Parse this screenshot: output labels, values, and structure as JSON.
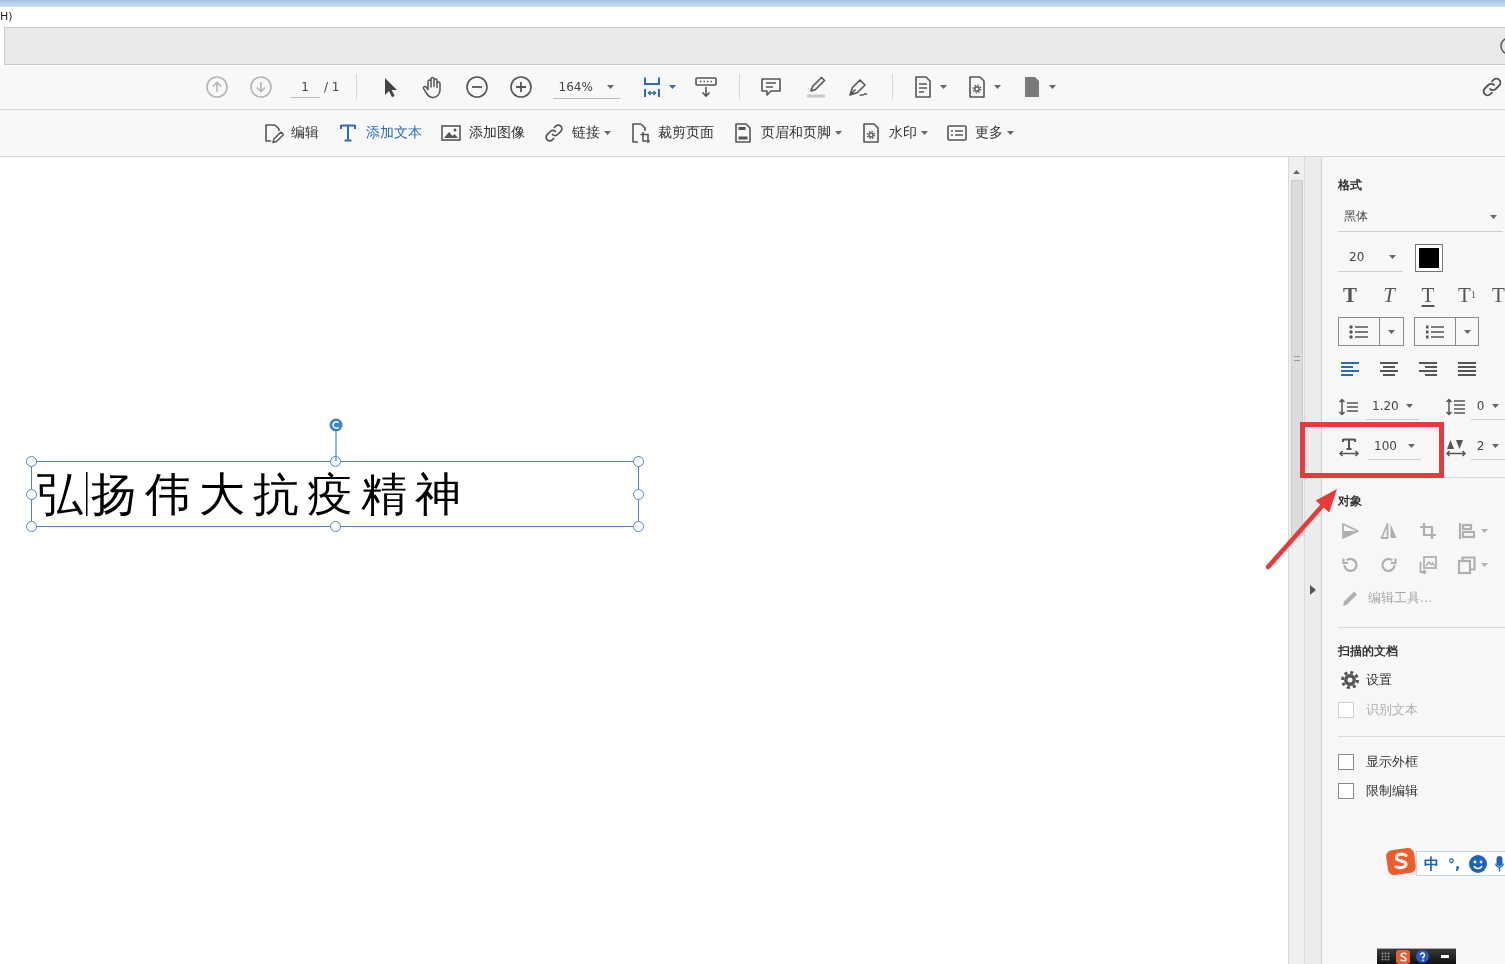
{
  "menu_bar": {
    "text": "H)"
  },
  "toolbar": {
    "nav": [
      {
        "disabled": true
      },
      {
        "disabled": true
      }
    ],
    "page_field": {
      "value": "1",
      "total": "/ 1"
    },
    "zoom_field": {
      "value": "164%"
    },
    "fit_page": {
      "selected": true
    }
  },
  "edit_tools": [
    {
      "label": "编辑",
      "selected": false,
      "dropdown": false
    },
    {
      "label": "添加文本",
      "selected": true,
      "dropdown": false
    },
    {
      "label": "添加图像",
      "selected": false,
      "dropdown": false
    },
    {
      "label": "链接",
      "selected": false,
      "dropdown": true
    },
    {
      "label": "裁剪页面",
      "selected": false,
      "dropdown": false
    },
    {
      "label": "页眉和页脚",
      "selected": false,
      "dropdown": true
    },
    {
      "label": "水印",
      "selected": false,
      "dropdown": true
    },
    {
      "label": "更多",
      "selected": false,
      "dropdown": true
    }
  ],
  "document": {
    "text_box": {
      "text": "弘扬伟大抗疫精神",
      "selected": true
    }
  },
  "format_panel": {
    "title": "格式",
    "font": {
      "value": "黑体"
    },
    "size": {
      "value": "20"
    },
    "color_swatch": {
      "color": "#000000"
    },
    "text_styles": [
      {
        "kind": "bold",
        "glyph": "T"
      },
      {
        "kind": "italic",
        "glyph": "T"
      },
      {
        "kind": "underline",
        "glyph": "T"
      },
      {
        "kind": "superscript",
        "glyph": "T$^{1}$"
      },
      {
        "kind": "subscript",
        "glyph": "T"
      }
    ],
    "lists": [
      {
        "kind": "bullet"
      },
      {
        "kind": "numbered"
      }
    ],
    "alignment": [
      {
        "kind": "left",
        "selected": true
      },
      {
        "kind": "center",
        "selected": false
      },
      {
        "kind": "right",
        "selected": false
      },
      {
        "kind": "justify",
        "selected": false
      }
    ],
    "line_spacing": {
      "value": "1.20"
    },
    "paragraph_spacing": {
      "value": "0"
    },
    "horizontal_scale": {
      "value": "100"
    },
    "character_spacing": {
      "value": "2"
    }
  },
  "object_panel": {
    "title": "对象",
    "disabled": true,
    "edit_tools_link": "编辑工具..."
  },
  "scanned_panel": {
    "title": "扫描的文档",
    "settings": "设置",
    "recognize": {
      "label": "识别文本",
      "checked": false,
      "disabled": true
    }
  },
  "options": [
    {
      "label": "显示外框",
      "checked": false
    },
    {
      "label": "限制编辑",
      "checked": false
    }
  ],
  "annotations": [
    {
      "kind": "frame"
    },
    {
      "kind": "arrow"
    }
  ],
  "ime_bar": {
    "mode": "中",
    "punctuation": "°,"
  }
}
